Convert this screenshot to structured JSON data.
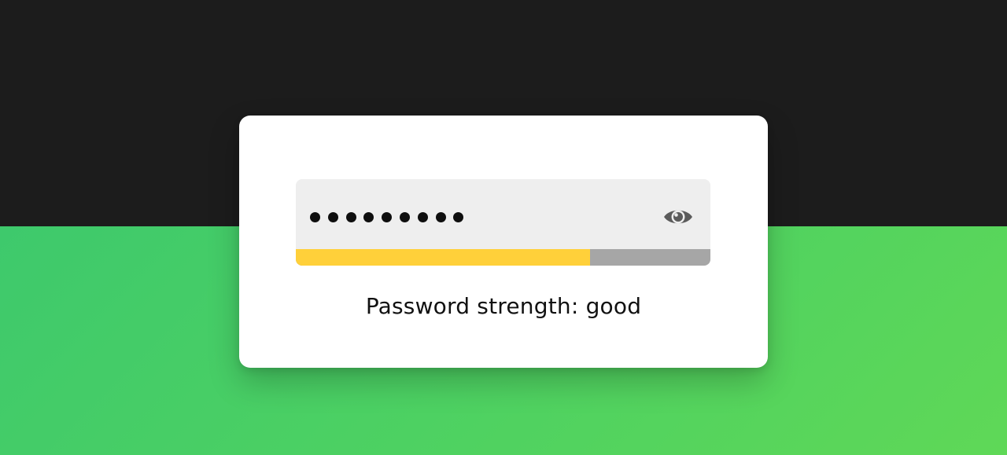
{
  "password_field": {
    "masked_value_length": 9,
    "visibility_toggle_icon": "eye-icon"
  },
  "strength_meter": {
    "level_fraction": 0.71,
    "fill_color": "#ffd03a",
    "track_color": "#a6a6a6"
  },
  "strength_text": "Password strength: good",
  "colors": {
    "background_top": "#1c1c1c",
    "background_bottom": "#4dd162",
    "card": "#ffffff",
    "field": "#eeeeee"
  }
}
